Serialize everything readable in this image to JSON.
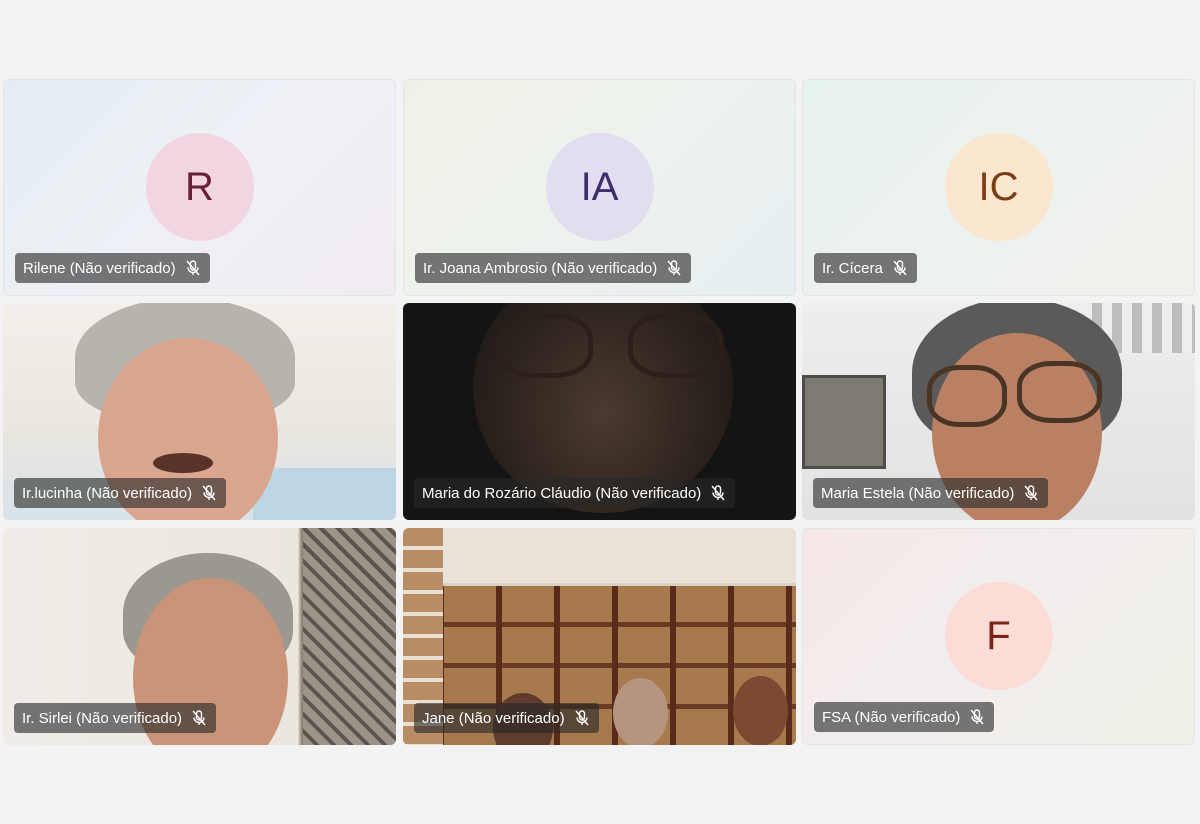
{
  "participants": [
    {
      "name": "Rilene (Não verificado)",
      "initials": "R",
      "type": "avatar",
      "avatar_bg": "#f1d6e2",
      "avatar_fg": "#6a1f3a",
      "muted": true
    },
    {
      "name": "Ir. Joana Ambrosio (Não verificado)",
      "initials": "IA",
      "type": "avatar",
      "avatar_bg": "#e3ddf0",
      "avatar_fg": "#3d2f6b",
      "muted": true
    },
    {
      "name": "Ir. Cícera",
      "initials": "IC",
      "type": "avatar",
      "avatar_bg": "#fbe6cf",
      "avatar_fg": "#7a3d12",
      "muted": true
    },
    {
      "name": "Ir.lucinha (Não verificado)",
      "type": "video",
      "muted": true
    },
    {
      "name": "Maria do Rozário Cláudio (Não verificado)",
      "type": "video",
      "muted": true
    },
    {
      "name": "Maria Estela (Não verificado)",
      "type": "video",
      "muted": true
    },
    {
      "name": "Ir. Sirlei (Não verificado)",
      "type": "video",
      "muted": true
    },
    {
      "name": "Jane (Não verificado)",
      "type": "video",
      "muted": true
    },
    {
      "name": "FSA (Não verificado)",
      "initials": "F",
      "type": "avatar",
      "avatar_bg": "#fbdcd6",
      "avatar_fg": "#7a2418",
      "muted": true
    }
  ]
}
